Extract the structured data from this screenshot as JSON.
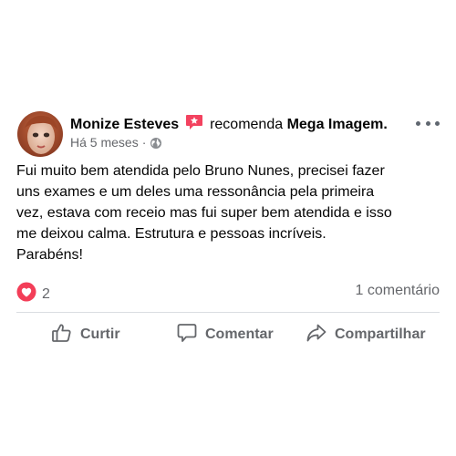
{
  "post": {
    "author": "Monize Esteves",
    "verb": "recomenda",
    "page": "Mega Imagem.",
    "time": "Há 5 meses",
    "separator": "·",
    "text_lines": [
      "Fui muito bem atendida pelo Bruno Nunes, precisei fazer",
      "uns exames e um deles uma ressonância pela primeira",
      "vez, estava com receio mas fui super bem atendida e isso",
      "me deixou calma. Estrutura e pessoas incríveis.",
      "Parabéns!"
    ]
  },
  "stats": {
    "reaction_count": "2",
    "comments": "1 comentário"
  },
  "actions": {
    "like": "Curtir",
    "comment": "Comentar",
    "share": "Compartilhar"
  },
  "icons": {
    "recommend": "recommend-icon",
    "globe": "globe-icon",
    "more": "more-options-icon",
    "reaction": "love-reaction-icon",
    "like": "thumbs-up-icon",
    "comment": "comment-bubble-icon",
    "share": "share-arrow-icon"
  },
  "colors": {
    "recommend_badge": "#f3425f",
    "love_reaction": "#f33e58",
    "secondary_text": "#65676b",
    "divider": "#dadde1"
  }
}
